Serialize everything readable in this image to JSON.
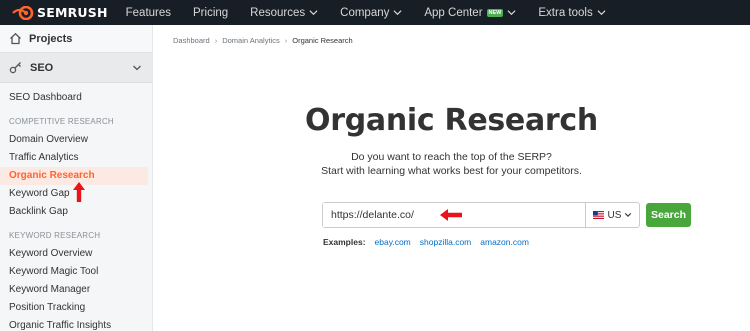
{
  "topnav": {
    "logo_text": "SEMRUSH",
    "items": [
      {
        "label": "Features",
        "has_chevron": false
      },
      {
        "label": "Pricing",
        "has_chevron": false
      },
      {
        "label": "Resources",
        "has_chevron": true
      },
      {
        "label": "Company",
        "has_chevron": true
      },
      {
        "label": "App Center",
        "has_chevron": true,
        "badge": "NEW"
      },
      {
        "label": "Extra tools",
        "has_chevron": true
      }
    ]
  },
  "sidebar": {
    "projects_label": "Projects",
    "seo_label": "SEO",
    "dashboard": "SEO Dashboard",
    "section_competitive": "COMPETITIVE RESEARCH",
    "competitive_items": [
      "Domain Overview",
      "Traffic Analytics",
      "Organic Research",
      "Keyword Gap",
      "Backlink Gap"
    ],
    "active_item": "Organic Research",
    "section_keyword": "KEYWORD RESEARCH",
    "keyword_items": [
      "Keyword Overview",
      "Keyword Magic Tool",
      "Keyword Manager",
      "Position Tracking",
      "Organic Traffic Insights"
    ]
  },
  "breadcrumb": [
    "Dashboard",
    "Domain Analytics",
    "Organic Research"
  ],
  "main": {
    "title": "Organic Research",
    "subtitle_line1": "Do you want to reach the top of the SERP?",
    "subtitle_line2": "Start with learning what works best for your competitors.",
    "search_value": "https://delante.co/",
    "database": "US",
    "search_button": "Search",
    "examples_label": "Examples:",
    "examples": [
      "ebay.com",
      "shopzilla.com",
      "amazon.com"
    ]
  },
  "colors": {
    "topbar": "#181e25",
    "brand_orange": "#ff642d",
    "search_green": "#48a63d",
    "link_blue": "#006dca",
    "annotation_red": "#e8141c"
  }
}
